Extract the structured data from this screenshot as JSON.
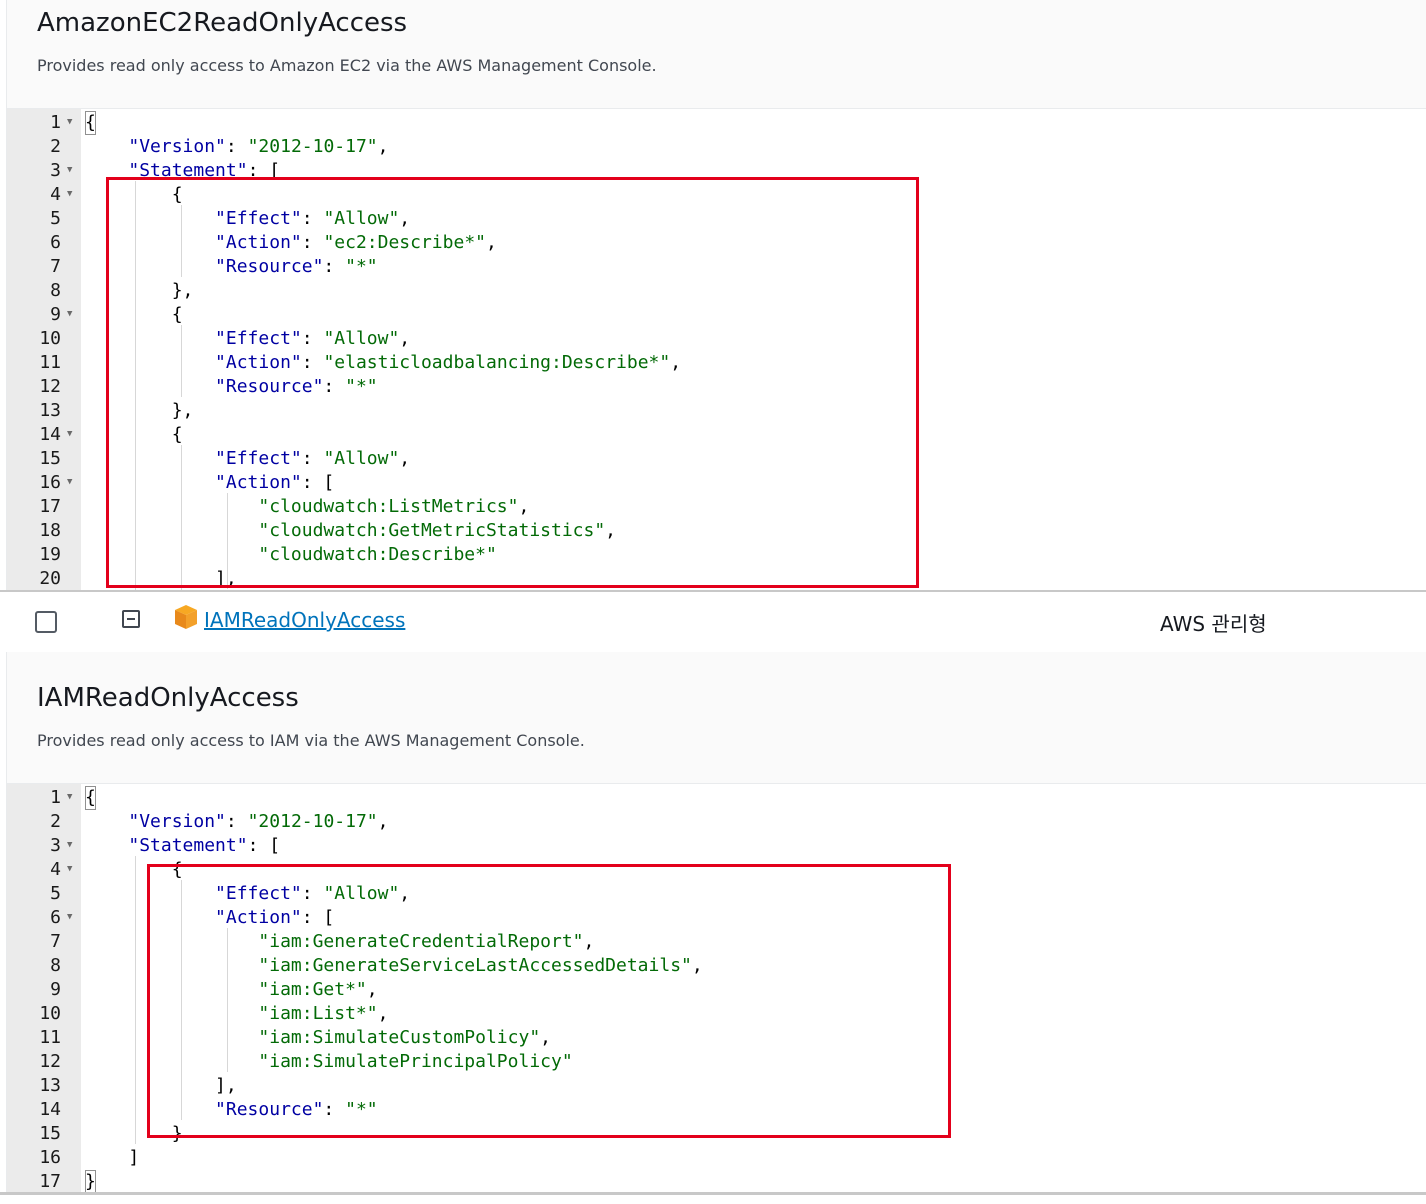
{
  "policy1": {
    "title": "AmazonEC2ReadOnlyAccess",
    "description": "Provides read only access to Amazon EC2 via the AWS Management Console.",
    "lines": [
      {
        "n": "1",
        "fold": true,
        "tokens": [
          {
            "t": "{",
            "c": "bracket"
          }
        ]
      },
      {
        "n": "2",
        "fold": false,
        "tokens": [
          {
            "t": "    "
          },
          {
            "t": "\"Version\"",
            "c": "k"
          },
          {
            "t": ": "
          },
          {
            "t": "\"2012-10-17\"",
            "c": "s"
          },
          {
            "t": ","
          }
        ]
      },
      {
        "n": "3",
        "fold": true,
        "tokens": [
          {
            "t": "    "
          },
          {
            "t": "\"Statement\"",
            "c": "k"
          },
          {
            "t": ": ["
          }
        ]
      },
      {
        "n": "4",
        "fold": true,
        "tokens": [
          {
            "t": "        {"
          }
        ]
      },
      {
        "n": "5",
        "fold": false,
        "tokens": [
          {
            "t": "            "
          },
          {
            "t": "\"Effect\"",
            "c": "k"
          },
          {
            "t": ": "
          },
          {
            "t": "\"Allow\"",
            "c": "s"
          },
          {
            "t": ","
          }
        ]
      },
      {
        "n": "6",
        "fold": false,
        "tokens": [
          {
            "t": "            "
          },
          {
            "t": "\"Action\"",
            "c": "k"
          },
          {
            "t": ": "
          },
          {
            "t": "\"ec2:Describe*\"",
            "c": "s"
          },
          {
            "t": ","
          }
        ]
      },
      {
        "n": "7",
        "fold": false,
        "tokens": [
          {
            "t": "            "
          },
          {
            "t": "\"Resource\"",
            "c": "k"
          },
          {
            "t": ": "
          },
          {
            "t": "\"*\"",
            "c": "s"
          }
        ]
      },
      {
        "n": "8",
        "fold": false,
        "tokens": [
          {
            "t": "        },"
          }
        ]
      },
      {
        "n": "9",
        "fold": true,
        "tokens": [
          {
            "t": "        {"
          }
        ]
      },
      {
        "n": "10",
        "fold": false,
        "tokens": [
          {
            "t": "            "
          },
          {
            "t": "\"Effect\"",
            "c": "k"
          },
          {
            "t": ": "
          },
          {
            "t": "\"Allow\"",
            "c": "s"
          },
          {
            "t": ","
          }
        ]
      },
      {
        "n": "11",
        "fold": false,
        "tokens": [
          {
            "t": "            "
          },
          {
            "t": "\"Action\"",
            "c": "k"
          },
          {
            "t": ": "
          },
          {
            "t": "\"elasticloadbalancing:Describe*\"",
            "c": "s"
          },
          {
            "t": ","
          }
        ]
      },
      {
        "n": "12",
        "fold": false,
        "tokens": [
          {
            "t": "            "
          },
          {
            "t": "\"Resource\"",
            "c": "k"
          },
          {
            "t": ": "
          },
          {
            "t": "\"*\"",
            "c": "s"
          }
        ]
      },
      {
        "n": "13",
        "fold": false,
        "tokens": [
          {
            "t": "        },"
          }
        ]
      },
      {
        "n": "14",
        "fold": true,
        "tokens": [
          {
            "t": "        {"
          }
        ]
      },
      {
        "n": "15",
        "fold": false,
        "tokens": [
          {
            "t": "            "
          },
          {
            "t": "\"Effect\"",
            "c": "k"
          },
          {
            "t": ": "
          },
          {
            "t": "\"Allow\"",
            "c": "s"
          },
          {
            "t": ","
          }
        ]
      },
      {
        "n": "16",
        "fold": true,
        "tokens": [
          {
            "t": "            "
          },
          {
            "t": "\"Action\"",
            "c": "k"
          },
          {
            "t": ": ["
          }
        ]
      },
      {
        "n": "17",
        "fold": false,
        "tokens": [
          {
            "t": "                "
          },
          {
            "t": "\"cloudwatch:ListMetrics\"",
            "c": "s"
          },
          {
            "t": ","
          }
        ]
      },
      {
        "n": "18",
        "fold": false,
        "tokens": [
          {
            "t": "                "
          },
          {
            "t": "\"cloudwatch:GetMetricStatistics\"",
            "c": "s"
          },
          {
            "t": ","
          }
        ]
      },
      {
        "n": "19",
        "fold": false,
        "tokens": [
          {
            "t": "                "
          },
          {
            "t": "\"cloudwatch:Describe*\"",
            "c": "s"
          }
        ]
      },
      {
        "n": "20",
        "fold": false,
        "tokens": [
          {
            "t": "            ],"
          }
        ]
      }
    ]
  },
  "row": {
    "policy_name": "IAMReadOnlyAccess",
    "policy_type": "AWS 관리형"
  },
  "policy2": {
    "title": "IAMReadOnlyAccess",
    "description": "Provides read only access to IAM via the AWS Management Console.",
    "lines": [
      {
        "n": "1",
        "fold": true,
        "tokens": [
          {
            "t": "{",
            "c": "bracket"
          }
        ]
      },
      {
        "n": "2",
        "fold": false,
        "tokens": [
          {
            "t": "    "
          },
          {
            "t": "\"Version\"",
            "c": "k"
          },
          {
            "t": ": "
          },
          {
            "t": "\"2012-10-17\"",
            "c": "s"
          },
          {
            "t": ","
          }
        ]
      },
      {
        "n": "3",
        "fold": true,
        "tokens": [
          {
            "t": "    "
          },
          {
            "t": "\"Statement\"",
            "c": "k"
          },
          {
            "t": ": ["
          }
        ]
      },
      {
        "n": "4",
        "fold": true,
        "tokens": [
          {
            "t": "        {"
          }
        ]
      },
      {
        "n": "5",
        "fold": false,
        "tokens": [
          {
            "t": "            "
          },
          {
            "t": "\"Effect\"",
            "c": "k"
          },
          {
            "t": ": "
          },
          {
            "t": "\"Allow\"",
            "c": "s"
          },
          {
            "t": ","
          }
        ]
      },
      {
        "n": "6",
        "fold": true,
        "tokens": [
          {
            "t": "            "
          },
          {
            "t": "\"Action\"",
            "c": "k"
          },
          {
            "t": ": ["
          }
        ]
      },
      {
        "n": "7",
        "fold": false,
        "tokens": [
          {
            "t": "                "
          },
          {
            "t": "\"iam:GenerateCredentialReport\"",
            "c": "s"
          },
          {
            "t": ","
          }
        ]
      },
      {
        "n": "8",
        "fold": false,
        "tokens": [
          {
            "t": "                "
          },
          {
            "t": "\"iam:GenerateServiceLastAccessedDetails\"",
            "c": "s"
          },
          {
            "t": ","
          }
        ]
      },
      {
        "n": "9",
        "fold": false,
        "tokens": [
          {
            "t": "                "
          },
          {
            "t": "\"iam:Get*\"",
            "c": "s"
          },
          {
            "t": ","
          }
        ]
      },
      {
        "n": "10",
        "fold": false,
        "tokens": [
          {
            "t": "                "
          },
          {
            "t": "\"iam:List*\"",
            "c": "s"
          },
          {
            "t": ","
          }
        ]
      },
      {
        "n": "11",
        "fold": false,
        "tokens": [
          {
            "t": "                "
          },
          {
            "t": "\"iam:SimulateCustomPolicy\"",
            "c": "s"
          },
          {
            "t": ","
          }
        ]
      },
      {
        "n": "12",
        "fold": false,
        "tokens": [
          {
            "t": "                "
          },
          {
            "t": "\"iam:SimulatePrincipalPolicy\"",
            "c": "s"
          }
        ]
      },
      {
        "n": "13",
        "fold": false,
        "tokens": [
          {
            "t": "            ],"
          }
        ]
      },
      {
        "n": "14",
        "fold": false,
        "tokens": [
          {
            "t": "            "
          },
          {
            "t": "\"Resource\"",
            "c": "k"
          },
          {
            "t": ": "
          },
          {
            "t": "\"*\"",
            "c": "s"
          }
        ]
      },
      {
        "n": "15",
        "fold": false,
        "tokens": [
          {
            "t": "        }"
          }
        ]
      },
      {
        "n": "16",
        "fold": false,
        "tokens": [
          {
            "t": "    ]"
          }
        ]
      },
      {
        "n": "17",
        "fold": false,
        "tokens": [
          {
            "t": "}",
            "c": "bracket"
          }
        ]
      }
    ]
  },
  "colors": {
    "key": "#0000a2",
    "string": "#036a07",
    "highlight_box": "#e3001b",
    "link": "#0073bb",
    "gutter": "#ebebeb"
  },
  "icons": {
    "fold": "fold-arrow-icon",
    "collapse": "collapse-minus-icon",
    "policy": "aws-policy-cube-icon"
  }
}
